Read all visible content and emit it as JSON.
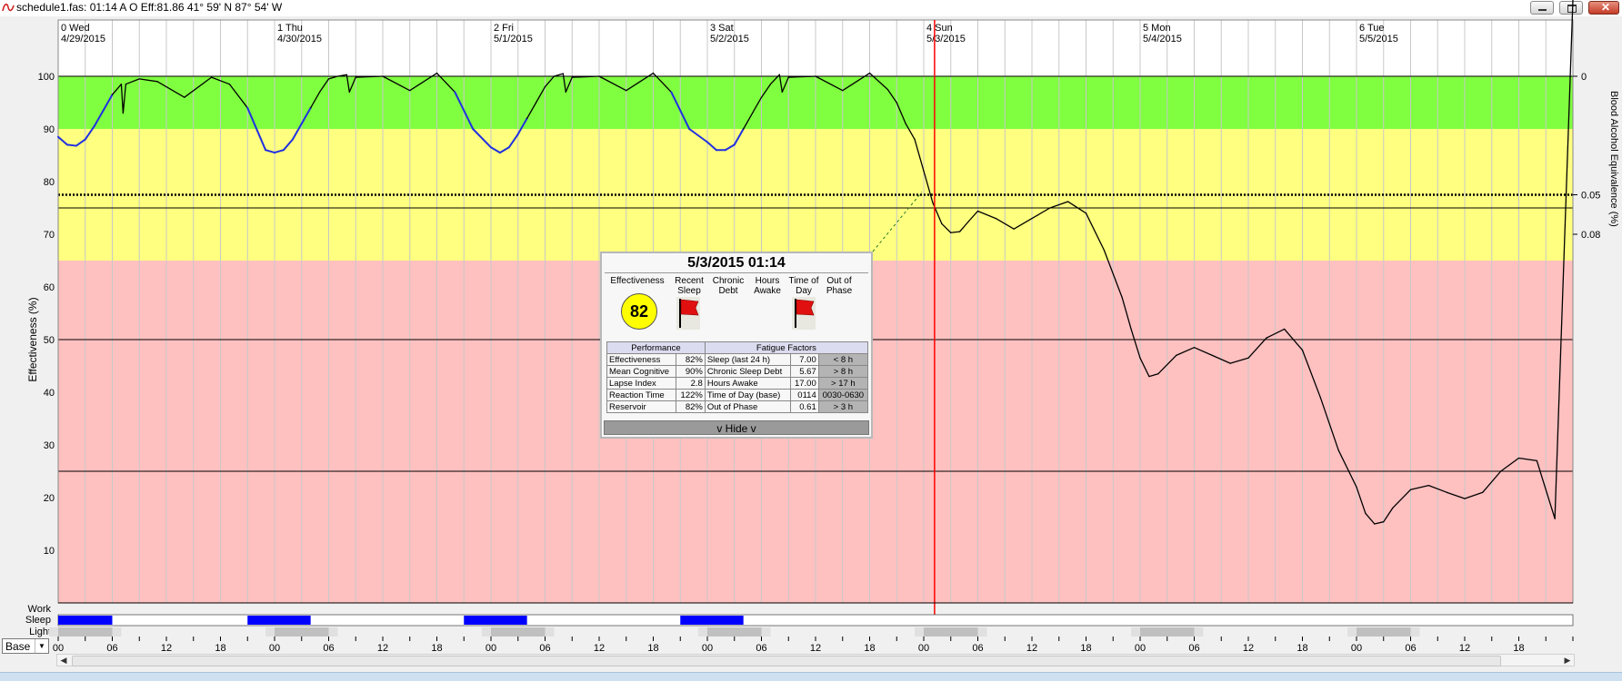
{
  "window": {
    "title": "schedule1.fas: 01:14 A O Eff:81.86  41° 59' N 87° 54' W",
    "buttons": [
      "minimize",
      "maximize",
      "close"
    ]
  },
  "days": [
    {
      "label": "0 Wed",
      "date": "4/29/2015"
    },
    {
      "label": "1 Thu",
      "date": "4/30/2015"
    },
    {
      "label": "2 Fri",
      "date": "5/1/2015"
    },
    {
      "label": "3 Sat",
      "date": "5/2/2015"
    },
    {
      "label": "4 Sun",
      "date": "5/3/2015"
    },
    {
      "label": "5 Mon",
      "date": "5/4/2015"
    },
    {
      "label": "6 Tue",
      "date": "5/5/2015"
    }
  ],
  "chart_data": {
    "type": "line",
    "ylabel": "Effectiveness (%)",
    "y2label": "Blood Alcohol Equivalence (%)",
    "ylim": [
      0,
      100
    ],
    "yticks": [
      10,
      20,
      30,
      40,
      50,
      60,
      70,
      80,
      90,
      100
    ],
    "y2ticks": [
      {
        "label": "0",
        "at": 100
      },
      {
        "label": "0.05",
        "at": 77.5
      },
      {
        "label": "0.08",
        "at": 70
      }
    ],
    "xlim_hours": [
      0,
      168
    ],
    "xticks": [
      "00",
      "06",
      "12",
      "18",
      "00",
      "06",
      "12",
      "18",
      "00",
      "06",
      "12",
      "18",
      "00",
      "06",
      "12",
      "18",
      "00",
      "06",
      "12",
      "18",
      "00",
      "06",
      "12",
      "18",
      "00",
      "06",
      "12",
      "18"
    ],
    "bands": [
      {
        "from": 90,
        "to": 100,
        "color": "#80ff40"
      },
      {
        "from": 65,
        "to": 90,
        "color": "#ffff80"
      },
      {
        "from": 0,
        "to": 65,
        "color": "#ffc0c0"
      }
    ],
    "reference_lines": [
      {
        "value": 77.5,
        "style": "dotted"
      },
      {
        "value": 75,
        "style": "solid"
      },
      {
        "value": 50,
        "style": "solid"
      },
      {
        "value": 25,
        "style": "solid"
      }
    ],
    "cursor_hour": 97.2,
    "sleep_color": "#2030e0",
    "wake_color": "#000000",
    "series": {
      "hours": [
        0,
        1,
        2,
        3,
        4,
        5,
        6,
        7,
        7.2,
        7.5,
        9,
        11,
        14,
        17,
        19,
        21,
        23,
        24,
        25,
        26,
        27,
        28,
        29,
        30,
        31,
        32,
        32.3,
        33,
        36,
        39,
        42,
        44,
        46,
        48,
        49,
        50,
        51,
        52,
        53,
        54,
        55,
        56,
        56.3,
        57,
        60,
        63,
        66,
        68,
        70,
        72,
        73,
        74,
        75,
        76,
        77,
        78,
        79,
        80,
        80.3,
        81,
        84,
        87,
        90,
        92,
        93,
        94,
        95,
        96,
        97,
        98,
        99,
        100,
        101,
        102,
        104,
        106,
        108,
        110,
        112,
        114,
        116,
        118,
        119,
        120,
        121,
        122,
        124,
        126,
        128,
        130,
        132,
        134,
        136,
        138,
        140,
        142,
        144,
        145,
        146,
        147,
        148,
        150,
        152,
        154,
        156,
        158,
        160,
        162,
        164,
        166,
        168
      ],
      "values": [
        88.5,
        87,
        86.8,
        88,
        90.5,
        93.5,
        96.5,
        98.5,
        93,
        98.5,
        99.5,
        99,
        96,
        99.8,
        98.5,
        94,
        86,
        85.5,
        86,
        88,
        91,
        94,
        97,
        99.5,
        100,
        100.3,
        97,
        99.8,
        100,
        97.3,
        100.6,
        97,
        90,
        86.5,
        85.5,
        86.5,
        89,
        92,
        95,
        98,
        100,
        100.5,
        97,
        99.8,
        100,
        97.3,
        100.6,
        97,
        90,
        87.5,
        86,
        86,
        87,
        90,
        93,
        96,
        98.5,
        100.3,
        97,
        99.8,
        100,
        97.3,
        100.6,
        97.5,
        95,
        91,
        88,
        82,
        76,
        72,
        70.3,
        70.5,
        72.5,
        74.4,
        73,
        71,
        73,
        75,
        76.2,
        74,
        67,
        58,
        52,
        46.5,
        43,
        43.5,
        47,
        48.5,
        47,
        45.5,
        46.5,
        50.3,
        52,
        48,
        39,
        29,
        22,
        17,
        15,
        15.4,
        18,
        21.5,
        22.3,
        21,
        19.8,
        21,
        25,
        27.5,
        27,
        16
      ]
    }
  },
  "bottom_bars": {
    "work_label": "Work",
    "sleep_label": "Sleep",
    "light_label": "Light",
    "sleep_blocks": [
      [
        0,
        6
      ],
      [
        21,
        28
      ],
      [
        45,
        52
      ],
      [
        69,
        76
      ]
    ],
    "dark_blocks": [
      [
        0,
        6
      ],
      [
        24,
        30
      ],
      [
        48,
        54
      ],
      [
        72,
        78
      ],
      [
        96,
        102
      ],
      [
        120,
        126
      ],
      [
        144,
        150
      ]
    ]
  },
  "scale_select": {
    "value": "Base"
  },
  "popup": {
    "title": "5/3/2015 01:14",
    "factor_headers": [
      "Effectiveness",
      "Recent Sleep",
      "Chronic Debt",
      "Hours Awake",
      "Time of Day",
      "Out of Phase"
    ],
    "effectiveness": "82",
    "flag_color": "#e01010",
    "table_headers": [
      "Performance",
      "Fatigue Factors"
    ],
    "rows": [
      {
        "label": "Effectiveness",
        "value": "82%",
        "factor": "Sleep (last 24 h)",
        "fvalue": "7.00",
        "threshold": "< 8 h"
      },
      {
        "label": "Mean Cognitive",
        "value": "90%",
        "factor": "Chronic Sleep Debt",
        "fvalue": "5.67",
        "threshold": "> 8 h"
      },
      {
        "label": "Lapse Index",
        "value": "2.8",
        "factor": "Hours Awake",
        "fvalue": "17.00",
        "threshold": "> 17 h"
      },
      {
        "label": "Reaction Time",
        "value": "122%",
        "factor": "Time of Day (base)",
        "fvalue": "0114",
        "threshold": "0030-0630"
      },
      {
        "label": "Reservoir",
        "value": "82%",
        "factor": "Out of Phase",
        "fvalue": "0.61",
        "threshold": "> 3 h"
      }
    ],
    "hide_label": "v Hide v"
  }
}
